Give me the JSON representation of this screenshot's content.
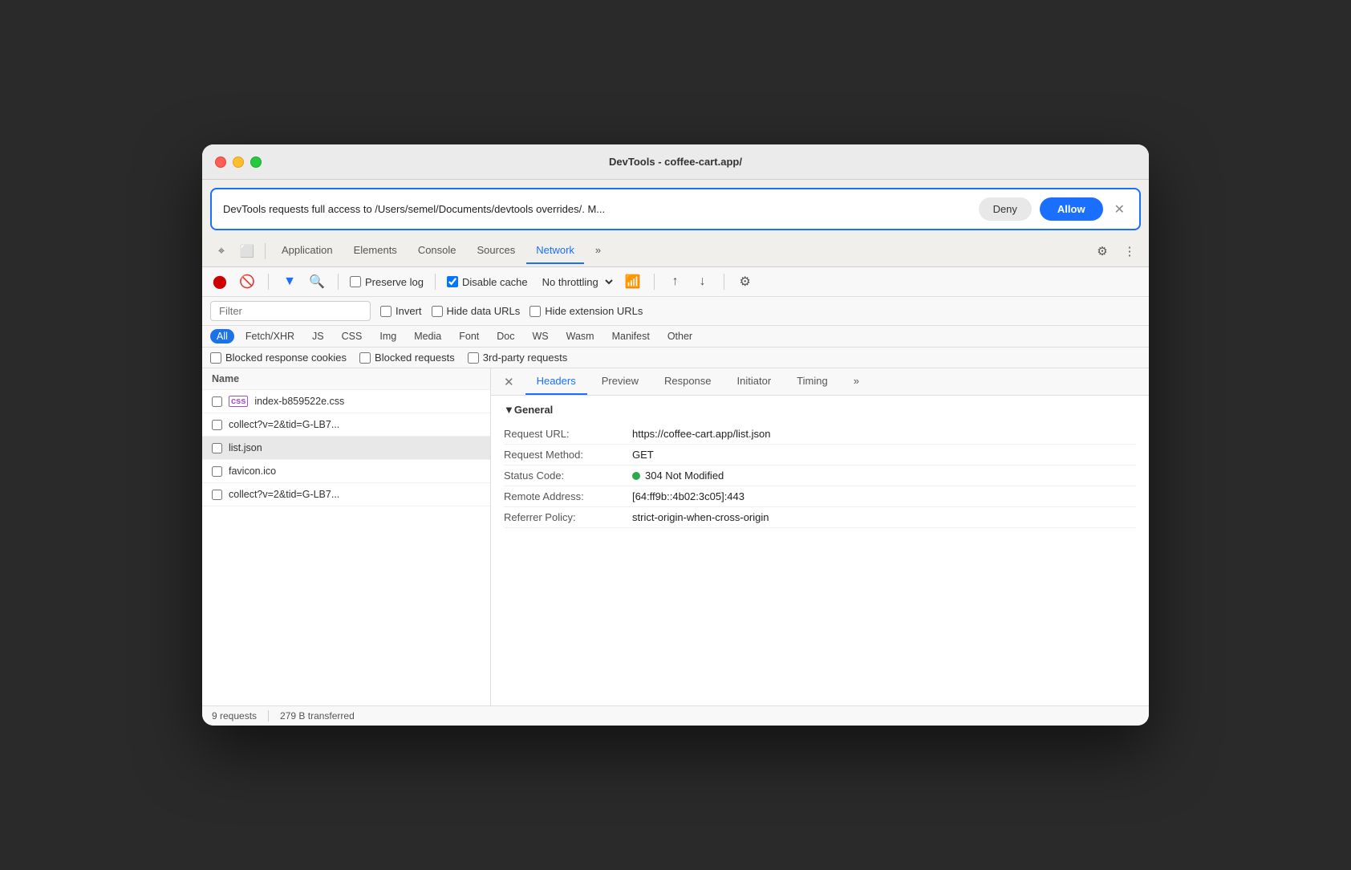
{
  "window": {
    "title": "DevTools - coffee-cart.app/"
  },
  "banner": {
    "text": "DevTools requests full access to /Users/semel/Documents/devtools overrides/. M...",
    "deny_label": "Deny",
    "allow_label": "Allow"
  },
  "nav": {
    "tabs": [
      {
        "label": "Application",
        "active": false
      },
      {
        "label": "Elements",
        "active": false
      },
      {
        "label": "Console",
        "active": false
      },
      {
        "label": "Sources",
        "active": false
      },
      {
        "label": "Network",
        "active": true
      },
      {
        "label": "»",
        "active": false
      }
    ]
  },
  "network_toolbar": {
    "preserve_log": "Preserve log",
    "disable_cache": "Disable cache",
    "no_throttling": "No throttling"
  },
  "filter": {
    "placeholder": "Filter",
    "invert": "Invert",
    "hide_data_urls": "Hide data URLs",
    "hide_extension_urls": "Hide extension URLs"
  },
  "type_filters": [
    {
      "label": "All",
      "active": true
    },
    {
      "label": "Fetch/XHR",
      "active": false
    },
    {
      "label": "JS",
      "active": false
    },
    {
      "label": "CSS",
      "active": false
    },
    {
      "label": "Img",
      "active": false
    },
    {
      "label": "Media",
      "active": false
    },
    {
      "label": "Font",
      "active": false
    },
    {
      "label": "Doc",
      "active": false
    },
    {
      "label": "WS",
      "active": false
    },
    {
      "label": "Wasm",
      "active": false
    },
    {
      "label": "Manifest",
      "active": false
    },
    {
      "label": "Other",
      "active": false
    }
  ],
  "checkbox_filters": [
    {
      "label": "Blocked response cookies"
    },
    {
      "label": "Blocked requests"
    },
    {
      "label": "3rd-party requests"
    }
  ],
  "file_list": {
    "header": "Name",
    "items": [
      {
        "name": "index-b859522e.css",
        "type": "css",
        "selected": false
      },
      {
        "name": "collect?v=2&tid=G-LB7...",
        "type": "checkbox",
        "selected": false
      },
      {
        "name": "list.json",
        "type": "checkbox",
        "selected": false,
        "highlighted": true
      },
      {
        "name": "favicon.ico",
        "type": "checkbox",
        "selected": false
      },
      {
        "name": "collect?v=2&tid=G-LB7...",
        "type": "checkbox",
        "selected": false
      }
    ]
  },
  "details": {
    "tabs": [
      {
        "label": "Headers",
        "active": true
      },
      {
        "label": "Preview",
        "active": false
      },
      {
        "label": "Response",
        "active": false
      },
      {
        "label": "Initiator",
        "active": false
      },
      {
        "label": "Timing",
        "active": false
      },
      {
        "label": "»",
        "active": false
      }
    ],
    "section_title": "▼General",
    "rows": [
      {
        "key": "Request URL:",
        "val": "https://coffee-cart.app/list.json",
        "has_dot": false
      },
      {
        "key": "Request Method:",
        "val": "GET",
        "has_dot": false
      },
      {
        "key": "Status Code:",
        "val": "304 Not Modified",
        "has_dot": true
      },
      {
        "key": "Remote Address:",
        "val": "[64:ff9b::4b02:3c05]:443",
        "has_dot": false
      },
      {
        "key": "Referrer Policy:",
        "val": "strict-origin-when-cross-origin",
        "has_dot": false
      }
    ]
  },
  "status_bar": {
    "requests": "9 requests",
    "transferred": "279 B transferred"
  }
}
